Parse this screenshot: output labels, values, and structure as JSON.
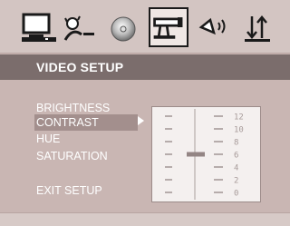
{
  "tabs": [
    {
      "name": "monitor-icon",
      "selected": false
    },
    {
      "name": "speaker-person-icon",
      "selected": false
    },
    {
      "name": "disc-icon",
      "selected": false
    },
    {
      "name": "video-camera-icon",
      "selected": true
    },
    {
      "name": "speaker-sound-icon",
      "selected": false
    },
    {
      "name": "sort-arrows-icon",
      "selected": false
    }
  ],
  "page": {
    "title": "VIDEO SETUP"
  },
  "menu": {
    "items": [
      {
        "label": "BRIGHTNESS",
        "selected": false
      },
      {
        "label": "CONTRAST",
        "selected": true
      },
      {
        "label": "HUE",
        "selected": false
      },
      {
        "label": "SATURATION",
        "selected": false
      },
      {
        "label": "EXIT SETUP",
        "selected": false
      }
    ]
  },
  "slider": {
    "scale_labels": [
      "12",
      "10",
      "8",
      "6",
      "4",
      "2",
      "0"
    ],
    "value": 6
  },
  "colors": {
    "background": "#c9b6b3",
    "title_bar": "#7b6d6c",
    "highlight": "#a38f8d",
    "text": "#ffffff"
  }
}
